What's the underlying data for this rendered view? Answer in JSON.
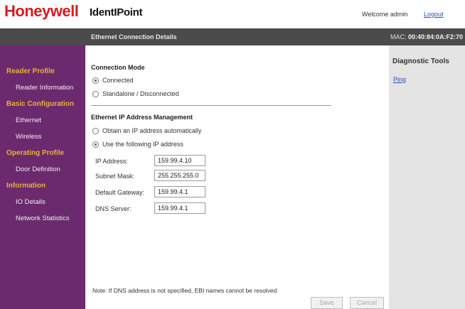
{
  "header": {
    "logo": "Honeywell",
    "app_title": "IdentIPoint",
    "welcome": "Welcome admin",
    "logout": "Logout"
  },
  "bar": {
    "section_title": "Ethernet Connection Details",
    "mac_label": "MAC:",
    "mac_value": "00:40:84:0A:F2:70"
  },
  "sidebar": {
    "reader_profile": "Reader Profile",
    "reader_information": "Reader Information",
    "basic_configuration": "Basic Configuration",
    "ethernet": "Ethernet",
    "wireless": "Wireless",
    "operating_profile": "Operating Profile",
    "door_definition": "Door Definition",
    "information": "Information",
    "io_details": "IO Details",
    "network_statistics": "Network Statistics"
  },
  "connection": {
    "title": "Connection Mode",
    "connected": "Connected",
    "standalone": "Standalone / Disconnected",
    "selected": "connected"
  },
  "ip": {
    "title": "Ethernet IP Address Management",
    "auto": "Obtain an IP address automatically",
    "manual": "Use the following IP address",
    "selected": "manual",
    "ip_label": "IP Address:",
    "ip_value": "159.99.4.10",
    "subnet_label": "Subnet Mask:",
    "subnet_value": "255.255.255.0",
    "gateway_label": "Default Gateway:",
    "gateway_value": "159.99.4.1",
    "dns_label": "DNS Server:",
    "dns_value": "159.99.4.1"
  },
  "footer": {
    "note": "Note: If DNS address is not specified, EBI names cannot be resolved",
    "save": "Save",
    "cancel": "Cancel"
  },
  "right_panel": {
    "title": "Diagnostic Tools",
    "ping": "Ping"
  },
  "colors": {
    "brand_red": "#d71920",
    "sidebar_purple": "#6b2a6e",
    "category_gold": "#e7b13a",
    "header_bar": "#4b4b4b",
    "link_blue": "#2a4fb8"
  }
}
